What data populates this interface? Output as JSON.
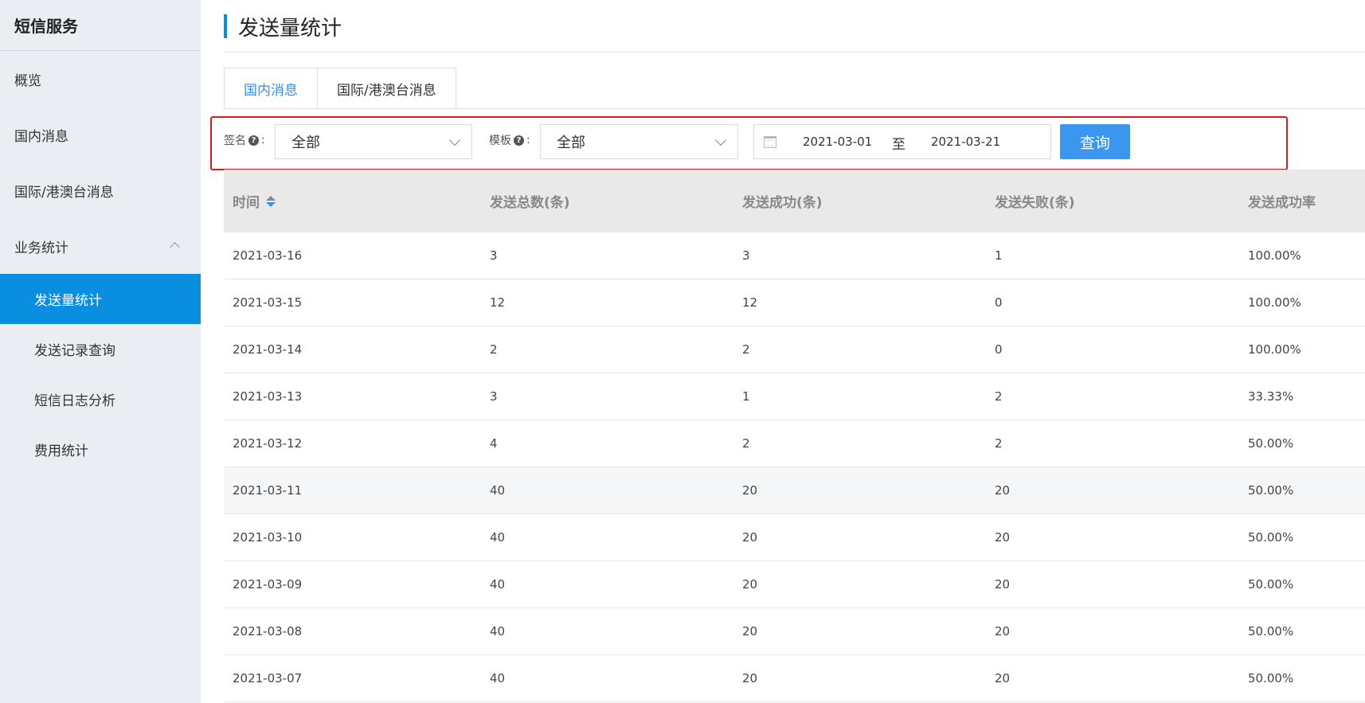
{
  "sidebar": {
    "brand": "短信服务",
    "items": [
      {
        "label": "概览"
      },
      {
        "label": "国内消息"
      },
      {
        "label": "国际/港澳台消息"
      },
      {
        "label": "业务统计"
      }
    ],
    "sub_items": [
      {
        "label": "发送量统计",
        "active": true
      },
      {
        "label": "发送记录查询"
      },
      {
        "label": "短信日志分析"
      },
      {
        "label": "费用统计"
      }
    ]
  },
  "header": {
    "title": "发送量统计"
  },
  "tabs": [
    {
      "label": "国内消息",
      "active": true
    },
    {
      "label": "国际/港澳台消息"
    }
  ],
  "filters": {
    "signature_label": "签名",
    "signature_value": "全部",
    "template_label": "模板",
    "template_value": "全部",
    "colon": ":",
    "help_glyph": "?",
    "date_start": "2021-03-01",
    "date_separator": "至",
    "date_end": "2021-03-21",
    "query_button": "查询"
  },
  "colors": {
    "accent": "#0a8ee0",
    "button": "#3a96ee",
    "highlight_border": "#e0181c"
  },
  "table": {
    "headers": [
      "时间",
      "发送总数(条)",
      "发送成功(条)",
      "发送失败(条)",
      "发送成功率"
    ],
    "rows": [
      [
        "2021-03-16",
        "3",
        "3",
        "1",
        "100.00%"
      ],
      [
        "2021-03-15",
        "12",
        "12",
        "0",
        "100.00%"
      ],
      [
        "2021-03-14",
        "2",
        "2",
        "0",
        "100.00%"
      ],
      [
        "2021-03-13",
        "3",
        "1",
        "2",
        "33.33%"
      ],
      [
        "2021-03-12",
        "4",
        "2",
        "2",
        "50.00%"
      ],
      [
        "2021-03-11",
        "40",
        "20",
        "20",
        "50.00%"
      ],
      [
        "2021-03-10",
        "40",
        "20",
        "20",
        "50.00%"
      ],
      [
        "2021-03-09",
        "40",
        "20",
        "20",
        "50.00%"
      ],
      [
        "2021-03-08",
        "40",
        "20",
        "20",
        "50.00%"
      ],
      [
        "2021-03-07",
        "40",
        "20",
        "20",
        "50.00%"
      ]
    ]
  }
}
